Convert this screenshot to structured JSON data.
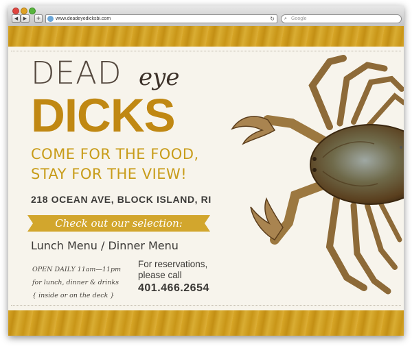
{
  "browser": {
    "url": "www.deadeyedicksbi.com",
    "search_placeholder": "Google",
    "back_icon": "◀",
    "forward_icon": "▶",
    "add_icon": "+",
    "reload_icon": "↻",
    "search_icon": "⌕"
  },
  "logo": {
    "dead": "DEAD",
    "eye": "eye",
    "dicks": "DICKS"
  },
  "tagline": {
    "line1": "COME FOR THE FOOD,",
    "line2": "STAY FOR THE VIEW!"
  },
  "address": "218 OCEAN AVE, BLOCK ISLAND, RI",
  "ribbon_text": "Check out our selection:",
  "menus": {
    "lunch": "Lunch Menu",
    "separator": " / ",
    "dinner": "Dinner Menu"
  },
  "hours": {
    "line1": "OPEN DAILY 11am—11pm",
    "line2": "for lunch, dinner & drinks",
    "line3": "{ inside or on the deck }"
  },
  "reservations": {
    "line1": "For reservations,",
    "line2": "please call",
    "phone": "401.466.2654"
  },
  "colors": {
    "gold": "#c99618",
    "dark_text": "#3a3835",
    "background": "#f7f4ec",
    "ribbon": "#d2a62d"
  }
}
